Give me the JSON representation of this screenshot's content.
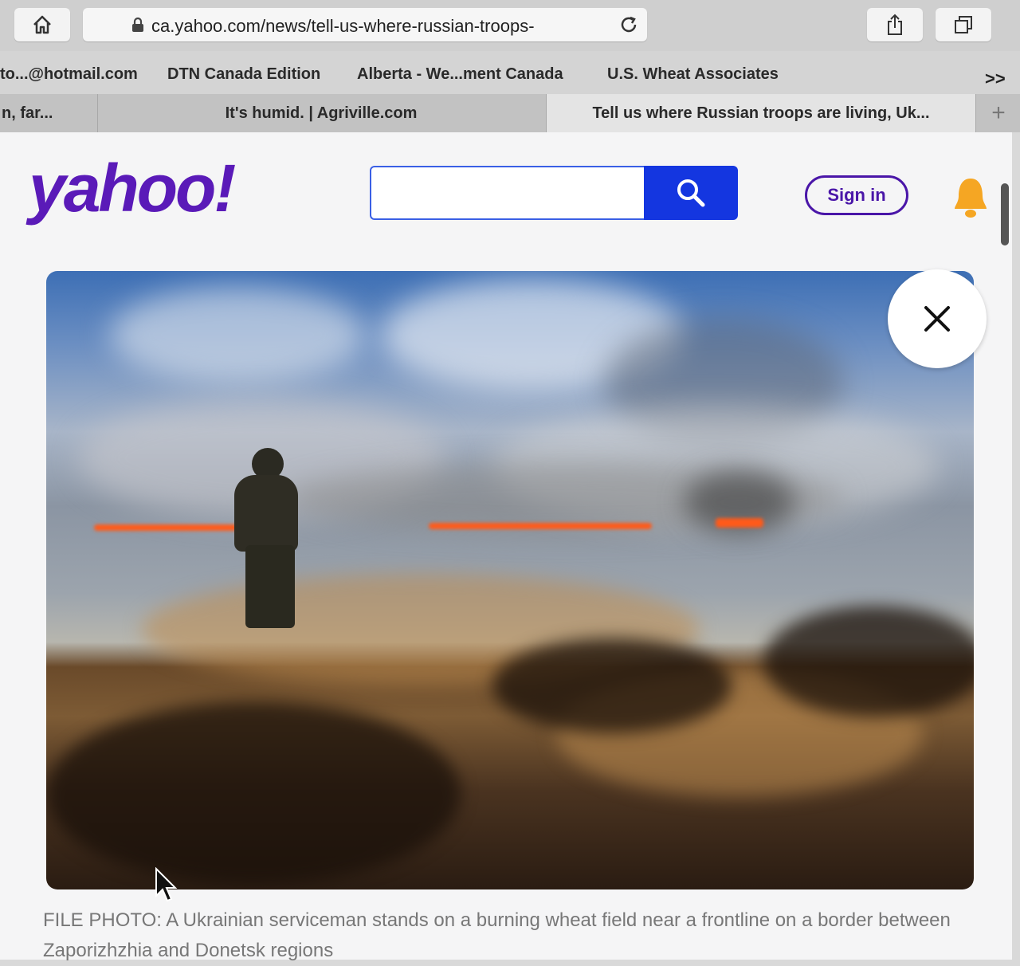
{
  "browser": {
    "url": "ca.yahoo.com/news/tell-us-where-russian-troops-",
    "icons": [
      "home-icon",
      "lock-icon",
      "reload-icon",
      "share-icon",
      "tabs-icon"
    ]
  },
  "bookmarks": [
    "to...@hotmail.com",
    "DTN Canada Edition",
    "Alberta - We...ment Canada",
    "U.S. Wheat Associates"
  ],
  "bookmarks_more": ">>",
  "tabs": [
    {
      "label": "n, far..."
    },
    {
      "label": "It's humid. | Agriville.com"
    },
    {
      "label": "Tell us where Russian troops are living, Uk...",
      "active": true
    }
  ],
  "tabs_new": "+",
  "header": {
    "logo": "yahoo!",
    "search_placeholder": "",
    "signin_label": "Sign in",
    "brand_color": "#5a1ab8",
    "search_button_color": "#1436e0"
  },
  "article": {
    "caption": "FILE PHOTO: A Ukrainian serviceman stands on a burning wheat field near a frontline on a border between Zaporizhzhia and Donetsk regions"
  }
}
